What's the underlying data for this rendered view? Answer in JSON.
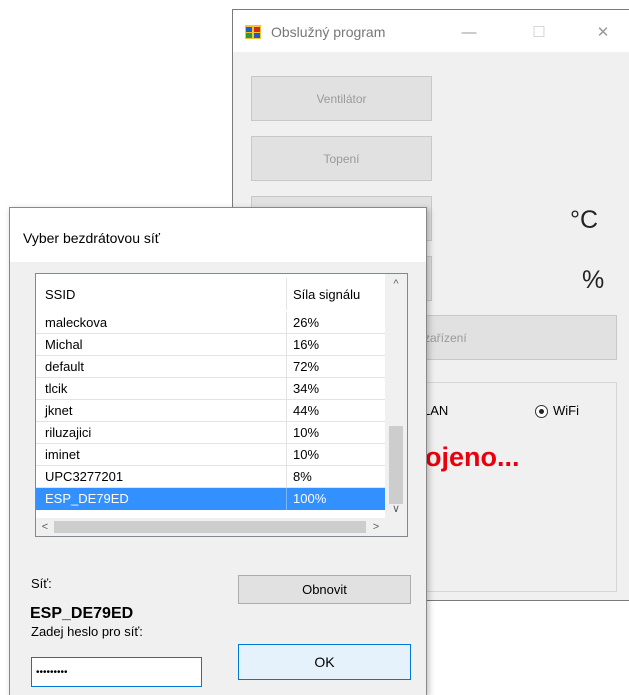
{
  "main_window": {
    "title": "Obslužný program",
    "controls": {
      "minimize": "—",
      "maximize": "☐",
      "close": "✕"
    },
    "buttons": {
      "fan": "Ventilátor",
      "heating": "Topení",
      "device": "zařízení"
    },
    "units": {
      "temperature": "°C",
      "humidity": "%"
    },
    "connection": {
      "lan_label": "LAN",
      "wifi_label": "WiFi",
      "selected": "WiFi"
    },
    "status_text": "ojeno..."
  },
  "dialog": {
    "title": "Vyber bezdrátovou síť",
    "list": {
      "columns": [
        "SSID",
        "Síla signálu"
      ],
      "rows": [
        {
          "ssid": "maleckova",
          "signal": "26%"
        },
        {
          "ssid": "Michal",
          "signal": "16%"
        },
        {
          "ssid": "default",
          "signal": "72%"
        },
        {
          "ssid": "tlcik",
          "signal": "34%"
        },
        {
          "ssid": "jknet",
          "signal": "44%"
        },
        {
          "ssid": "riluzajici",
          "signal": "10%"
        },
        {
          "ssid": "iminet",
          "signal": "10%"
        },
        {
          "ssid": "UPC3277201",
          "signal": "8%"
        },
        {
          "ssid": "ESP_DE79ED",
          "signal": "100%"
        }
      ],
      "selected_index": 8
    },
    "network_label": "Síť:",
    "network_name": "ESP_DE79ED",
    "password_label": "Zadej heslo pro síť:",
    "password_value": "•••••••••",
    "refresh_button": "Obnovit",
    "ok_button": "OK"
  },
  "colors": {
    "selection": "#3390ff",
    "status": "#e8000d",
    "ok_border": "#0078d7"
  }
}
